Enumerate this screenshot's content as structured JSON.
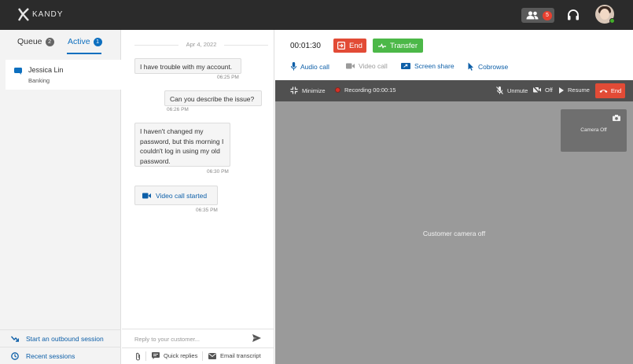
{
  "header": {
    "logo_text": "KANDY",
    "team_badge": "5",
    "team_icon": "people-icon",
    "headset_icon": "headset-icon"
  },
  "left": {
    "tabs": [
      {
        "label": "Queue",
        "count": "2"
      },
      {
        "label": "Active",
        "count": "1"
      }
    ],
    "active_tab": "Active",
    "sessions": [
      {
        "name": "Jessica Lin",
        "subtitle": "Banking",
        "icon": "chat-icon"
      }
    ],
    "footer_links": [
      {
        "label": "Start an outbound session",
        "icon": "outbound-arrow-icon"
      },
      {
        "label": "Recent sessions",
        "icon": "clock-icon"
      }
    ]
  },
  "chat": {
    "date": "Apr 4, 2022",
    "messages": [
      {
        "text": "I have trouble with my account.",
        "time": "06:25 PM",
        "from": "customer"
      },
      {
        "text": "Can you describe the issue?",
        "time": "06:26 PM",
        "from": "agent"
      },
      {
        "text": "I haven't changed my password, but this morning I couldn't log in using my old password.",
        "time": "06:30 PM",
        "from": "customer"
      }
    ],
    "event": {
      "text": "Video call started",
      "time": "06:35 PM"
    },
    "composer_placeholder": "Reply to your customer...",
    "tools": {
      "quick_replies": "Quick replies",
      "email_transcript": "Email transcript"
    }
  },
  "call": {
    "timer": "00:01:30",
    "end_label": "End",
    "transfer_label": "Transfer",
    "media": {
      "audio": "Audio call",
      "video": "Video call",
      "screen": "Screen share",
      "cobrowse": "Cobrowse"
    },
    "videobar": {
      "minimize": "Minimize",
      "recording": "Recording 00:00:15",
      "unmute": "Unmute",
      "off": "Off",
      "resume": "Resume",
      "end": "End"
    },
    "customer_status": "Customer camera off",
    "selfview_status": "Camera Off"
  },
  "colors": {
    "topbar": "#2b2b2b",
    "accent_blue": "#0d6fbf",
    "end_red": "#e24b36",
    "transfer_green": "#4cb848",
    "video_bg": "#9a9a9a"
  }
}
